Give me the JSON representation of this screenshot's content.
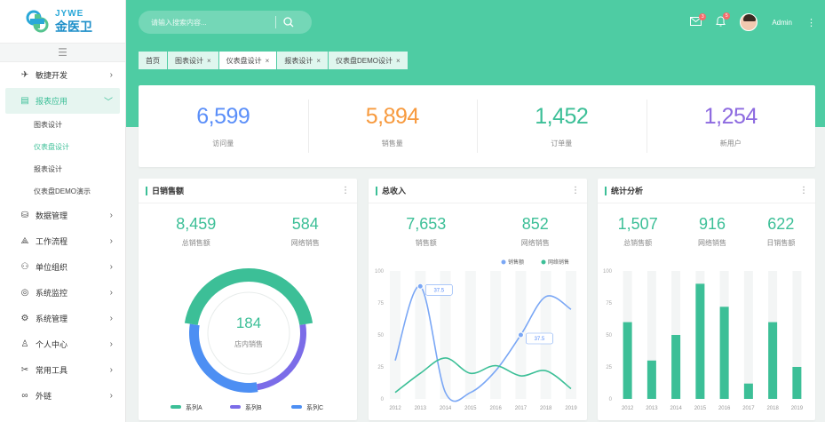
{
  "brand": {
    "en": "JYWE",
    "cn": "金医卫"
  },
  "sidebar": {
    "collapse_glyph": "☰",
    "menu": [
      {
        "label": "敏捷开发",
        "icon": "rocket-icon",
        "glyph": "✈"
      },
      {
        "label": "报表应用",
        "icon": "report-icon",
        "glyph": "▤",
        "active": true,
        "children": [
          {
            "label": "图表设计"
          },
          {
            "label": "仪表盘设计",
            "active": true
          },
          {
            "label": "报表设计"
          },
          {
            "label": "仪表盘DEMO演示"
          }
        ]
      },
      {
        "label": "数据管理",
        "icon": "database-icon",
        "glyph": "⛁"
      },
      {
        "label": "工作流程",
        "icon": "workflow-icon",
        "glyph": "⟁"
      },
      {
        "label": "单位组织",
        "icon": "organization-icon",
        "glyph": "⚇"
      },
      {
        "label": "系统监控",
        "icon": "monitor-icon",
        "glyph": "◎"
      },
      {
        "label": "系统管理",
        "icon": "settings-icon",
        "glyph": "⚙"
      },
      {
        "label": "个人中心",
        "icon": "user-icon",
        "glyph": "♙"
      },
      {
        "label": "常用工具",
        "icon": "tools-icon",
        "glyph": "✂"
      },
      {
        "label": "外链",
        "icon": "link-icon",
        "glyph": "∞"
      }
    ]
  },
  "header": {
    "search_placeholder": "请输入搜索内容...",
    "mail_badge": "3",
    "bell_badge": "5",
    "user_name": "Admin"
  },
  "tabs": [
    {
      "label": "首页",
      "closable": false
    },
    {
      "label": "图表设计",
      "closable": true
    },
    {
      "label": "仪表盘设计",
      "closable": true,
      "active": true
    },
    {
      "label": "报表设计",
      "closable": true
    },
    {
      "label": "仪表盘DEMO设计",
      "closable": true
    }
  ],
  "stats": [
    {
      "value": "6,599",
      "label": "访问量",
      "color": "#5b8ff9"
    },
    {
      "value": "5,894",
      "label": "销售量",
      "color": "#f79a3e"
    },
    {
      "value": "1,452",
      "label": "订单量",
      "color": "#3cbf97"
    },
    {
      "value": "1,254",
      "label": "新用户",
      "color": "#8d6ae0"
    }
  ],
  "panels": {
    "daily": {
      "title": "日销售额",
      "stats": [
        {
          "value": "8,459",
          "label": "总销售额"
        },
        {
          "value": "584",
          "label": "网络销售"
        }
      ],
      "center_value": "184",
      "center_label": "店内销售"
    },
    "total": {
      "title": "总收入",
      "stats": [
        {
          "value": "7,653",
          "label": "销售额"
        },
        {
          "value": "852",
          "label": "网络销售"
        }
      ]
    },
    "analysis": {
      "title": "统计分析",
      "stats": [
        {
          "value": "1,507",
          "label": "总销售额"
        },
        {
          "value": "916",
          "label": "网络销售"
        },
        {
          "value": "622",
          "label": "日销售额"
        }
      ]
    }
  },
  "chart_data": [
    {
      "type": "pie",
      "title": "",
      "labels": [
        "系列A",
        "系列B",
        "系列C"
      ],
      "values": [
        45,
        25,
        30
      ],
      "colors": [
        "#3cbf97",
        "#7b6ce8",
        "#4d8ff3"
      ]
    },
    {
      "type": "line",
      "title": "",
      "x": [
        "2012",
        "2013",
        "2014",
        "2015",
        "2016",
        "2017",
        "2018",
        "2019"
      ],
      "ylim": [
        0,
        100
      ],
      "yticks": [
        0,
        25,
        50,
        75,
        100
      ],
      "series": [
        {
          "name": "销售额",
          "values": [
            30,
            88,
            5,
            5,
            22,
            50,
            80,
            70
          ],
          "color": "#7aa7f5"
        },
        {
          "name": "网络销售",
          "values": [
            5,
            20,
            32,
            20,
            26,
            18,
            22,
            8
          ],
          "color": "#3cbf97"
        }
      ],
      "annotations": [
        {
          "x": "2013",
          "series": 0,
          "text": "37.5"
        },
        {
          "x": "2017",
          "series": 0,
          "text": "37.5"
        }
      ],
      "legend": "top-right"
    },
    {
      "type": "bar",
      "title": "",
      "categories": [
        "2012",
        "2013",
        "2014",
        "2015",
        "2016",
        "2017",
        "2018",
        "2019"
      ],
      "values": [
        60,
        30,
        50,
        90,
        72,
        12,
        60,
        25
      ],
      "ylim": [
        0,
        100
      ],
      "yticks": [
        0,
        25,
        50,
        75,
        100
      ],
      "color": "#3cbf97"
    }
  ]
}
